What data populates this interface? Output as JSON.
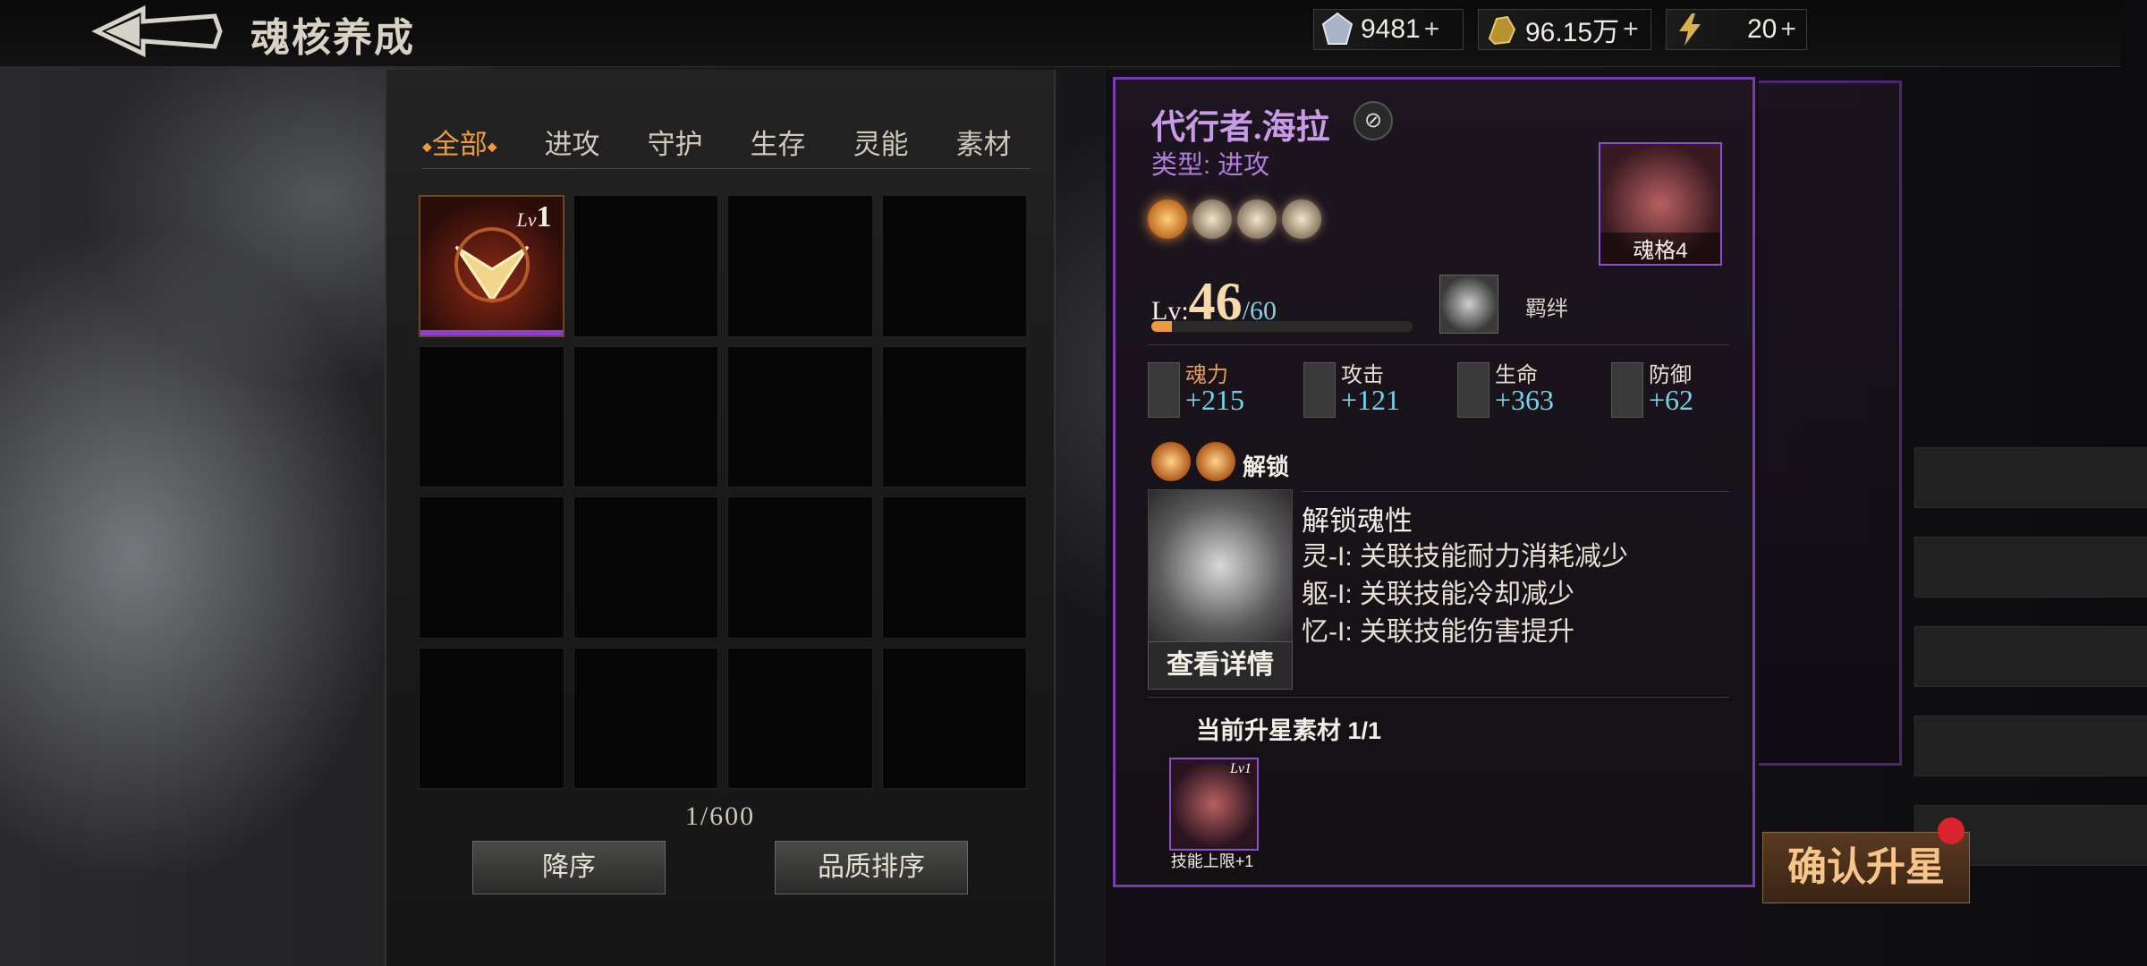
{
  "header": {
    "title": "魂核养成",
    "resources": [
      {
        "icon": "crystal-icon",
        "value": "9481",
        "plus": "+"
      },
      {
        "icon": "gold-coin-icon",
        "value": "96.15万",
        "plus": "+"
      },
      {
        "icon": "lightning-icon",
        "value": "20",
        "plus": "+"
      }
    ]
  },
  "inventory": {
    "tabs": [
      "全部",
      "进攻",
      "守护",
      "生存",
      "灵能",
      "素材"
    ],
    "active_tab": "全部",
    "item": {
      "lv_prefix": "Lv",
      "level": "1"
    },
    "count": "1/600",
    "sort_desc_label": "降序",
    "quality_sort_label": "品质排序"
  },
  "detail": {
    "name": "代行者.海拉",
    "type_label": "类型: 进攻",
    "portrait_label": "魂格4",
    "stars_total": 4,
    "stars_filled": 1,
    "lv_prefix": "Lv:",
    "level": "46",
    "max_level": "/60",
    "xp_fraction": 0.08,
    "bond_label": "羁绊",
    "stats": [
      {
        "label": "魂力",
        "value": "+215",
        "icon": "soul-power-icon"
      },
      {
        "label": "攻击",
        "value": "+121",
        "icon": "attack-icon"
      },
      {
        "label": "生命",
        "value": "+363",
        "icon": "life-icon"
      },
      {
        "label": "防御",
        "value": "+62",
        "icon": "defense-icon"
      }
    ],
    "unlock_label": "解锁",
    "unlock_title": "解锁魂性",
    "unlock_lines": [
      "灵-I: 关联技能耐力消耗减少",
      "躯-I: 关联技能冷却减少",
      "忆-I: 关联技能伤害提升"
    ],
    "view_details_label": "查看详情",
    "material_header": "当前升星素材 1/1",
    "material_card": {
      "lv_prefix": "Lv",
      "level": "1",
      "caption": "技能上限+1"
    }
  },
  "confirm_label": "确认升星"
}
